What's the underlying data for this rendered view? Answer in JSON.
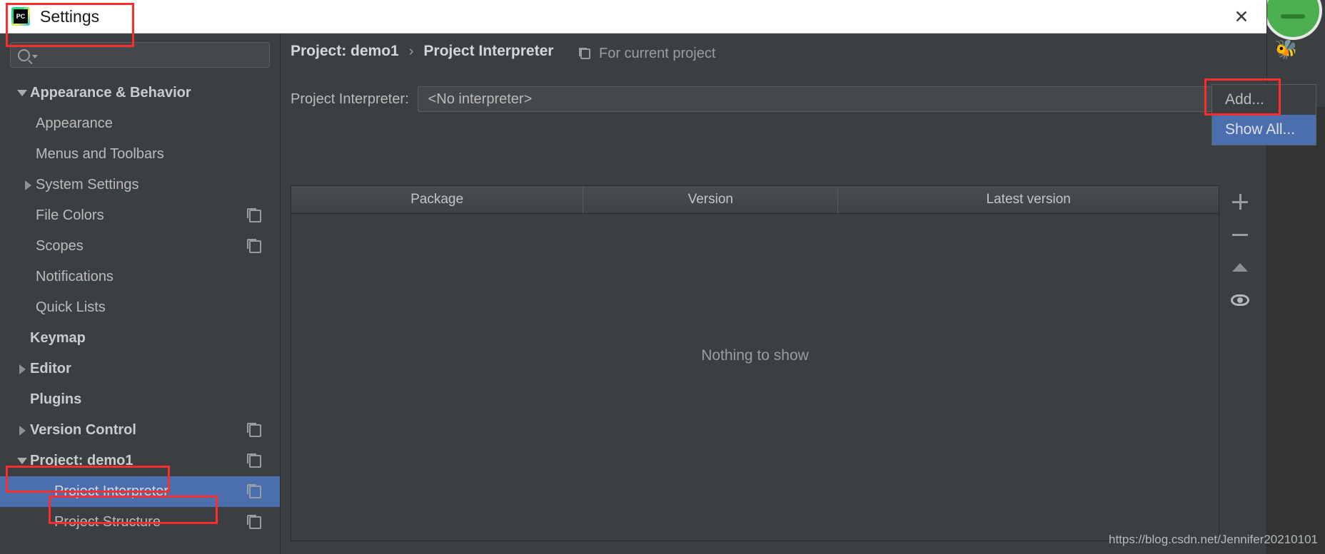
{
  "window": {
    "title": "Settings",
    "logo_icon": "pycharm-logo-icon",
    "close_icon": "close-icon"
  },
  "search": {
    "value": "",
    "placeholder": "",
    "icon": "search-icon",
    "caret_icon": "chevron-down-icon"
  },
  "sidebar": {
    "items": [
      {
        "label": "Appearance & Behavior",
        "level": 0,
        "bold": true,
        "arrow": "down",
        "copy": false,
        "selected": false
      },
      {
        "label": "Appearance",
        "level": 1,
        "bold": false,
        "arrow": "none",
        "copy": false,
        "selected": false
      },
      {
        "label": "Menus and Toolbars",
        "level": 1,
        "bold": false,
        "arrow": "none",
        "copy": false,
        "selected": false
      },
      {
        "label": "System Settings",
        "level": 1,
        "bold": false,
        "arrow": "right",
        "copy": false,
        "selected": false
      },
      {
        "label": "File Colors",
        "level": 1,
        "bold": false,
        "arrow": "none",
        "copy": true,
        "selected": false
      },
      {
        "label": "Scopes",
        "level": 1,
        "bold": false,
        "arrow": "none",
        "copy": true,
        "selected": false
      },
      {
        "label": "Notifications",
        "level": 1,
        "bold": false,
        "arrow": "none",
        "copy": false,
        "selected": false
      },
      {
        "label": "Quick Lists",
        "level": 1,
        "bold": false,
        "arrow": "none",
        "copy": false,
        "selected": false
      },
      {
        "label": "Keymap",
        "level": 0,
        "bold": true,
        "arrow": "none",
        "copy": false,
        "selected": false
      },
      {
        "label": "Editor",
        "level": 0,
        "bold": true,
        "arrow": "right",
        "copy": false,
        "selected": false
      },
      {
        "label": "Plugins",
        "level": 0,
        "bold": true,
        "arrow": "none",
        "copy": false,
        "selected": false
      },
      {
        "label": "Version Control",
        "level": 0,
        "bold": true,
        "arrow": "right",
        "copy": true,
        "selected": false
      },
      {
        "label": "Project: demo1",
        "level": 0,
        "bold": true,
        "arrow": "down",
        "copy": true,
        "selected": false
      },
      {
        "label": "Project Interpreter",
        "level": 2,
        "bold": false,
        "arrow": "none",
        "copy": true,
        "selected": true
      },
      {
        "label": "Project Structure",
        "level": 2,
        "bold": false,
        "arrow": "none",
        "copy": true,
        "selected": false
      }
    ]
  },
  "content": {
    "breadcrumb": {
      "root": "Project: demo1",
      "separator": "›",
      "current": "Project Interpreter"
    },
    "scope_label": "For current project",
    "scope_icon": "copy-icon",
    "interpreter": {
      "label": "Project Interpreter:",
      "value": "<No interpreter>",
      "caret_icon": "chevron-down-icon"
    },
    "dropdown": {
      "items": [
        {
          "label": "Add...",
          "highlighted": false
        },
        {
          "label": "Show All...",
          "highlighted": true
        }
      ]
    },
    "table": {
      "columns": [
        "Package",
        "Version",
        "Latest version"
      ],
      "rows": [],
      "empty_text": "Nothing to show"
    },
    "side_tools": [
      {
        "name": "add-package-button",
        "icon": "plus-icon"
      },
      {
        "name": "remove-package-button",
        "icon": "minus-icon"
      },
      {
        "name": "upgrade-package-button",
        "icon": "triangle-up-icon"
      },
      {
        "name": "show-early-releases-button",
        "icon": "eye-icon"
      }
    ]
  },
  "watermark": "https://blog.csdn.net/Jennifer20210101",
  "colors": {
    "selection": "#4b6eaf",
    "annotation": "#fc2d2d",
    "panel": "#3c3f41",
    "titlebar": "#ffffff"
  }
}
